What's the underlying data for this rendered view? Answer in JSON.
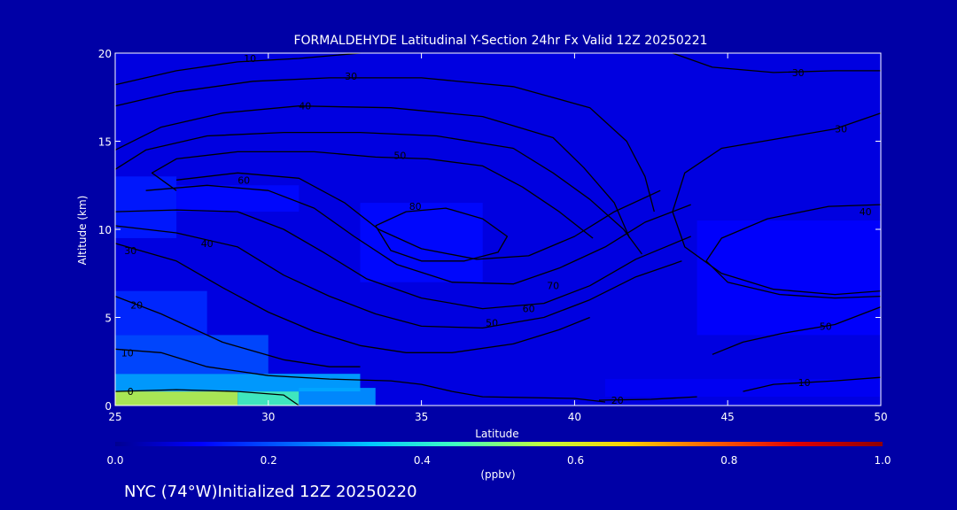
{
  "chart_data": {
    "type": "heatmap",
    "title": "FORMALDEHYDE Latitudinal Y-Section 24hr  Fx Valid 12Z 20250221",
    "xlabel": "Latitude",
    "ylabel": "Altitude (km)",
    "xlim": [
      25,
      50
    ],
    "ylim": [
      0,
      20
    ],
    "x_ticks": [
      "25",
      "30",
      "35",
      "40",
      "45",
      "50"
    ],
    "y_ticks": [
      "0",
      "5",
      "10",
      "15",
      "20"
    ],
    "colorbar": {
      "label": "(ppbv)",
      "range": [
        0.0,
        1.0
      ],
      "ticks": [
        "0.0",
        "0.2",
        "0.4",
        "0.6",
        "0.8",
        "1.0"
      ],
      "colors": [
        "#000090",
        "#0000ff",
        "#0060ff",
        "#00c8ff",
        "#40ffc0",
        "#c0ff40",
        "#ffd000",
        "#ff6000",
        "#e00000",
        "#900000"
      ]
    },
    "field_regions": [
      {
        "lat": [
          25,
          29
        ],
        "alt": [
          0,
          0.8
        ],
        "value": 0.55
      },
      {
        "lat": [
          29,
          31
        ],
        "alt": [
          0,
          0.8
        ],
        "value": 0.45
      },
      {
        "lat": [
          31,
          33.5
        ],
        "alt": [
          0,
          1.0
        ],
        "value": 0.28
      },
      {
        "lat": [
          25,
          33
        ],
        "alt": [
          0.8,
          1.8
        ],
        "value": 0.3
      },
      {
        "lat": [
          25,
          30
        ],
        "alt": [
          1.8,
          4.0
        ],
        "value": 0.2
      },
      {
        "lat": [
          25,
          28
        ],
        "alt": [
          4.0,
          6.5
        ],
        "value": 0.16
      },
      {
        "lat": [
          25,
          27
        ],
        "alt": [
          9.5,
          13.0
        ],
        "value": 0.14
      },
      {
        "lat": [
          27,
          31
        ],
        "alt": [
          11.0,
          12.5
        ],
        "value": 0.12
      },
      {
        "lat": [
          33,
          37
        ],
        "alt": [
          7.0,
          11.5
        ],
        "value": 0.12
      },
      {
        "lat": [
          41,
          50
        ],
        "alt": [
          0.5,
          1.5
        ],
        "value": 0.1
      },
      {
        "lat": [
          44,
          50
        ],
        "alt": [
          4.0,
          10.5
        ],
        "value": 0.11
      }
    ],
    "contours": [
      {
        "label": "0",
        "label_at": [
          25.5,
          0.8
        ],
        "points": [
          [
            25,
            0.8
          ],
          [
            27,
            0.9
          ],
          [
            29,
            0.8
          ],
          [
            30.5,
            0.6
          ],
          [
            31,
            0
          ]
        ]
      },
      {
        "label": "10",
        "label_at": [
          25.4,
          3.0
        ],
        "points": [
          [
            25,
            3.2
          ],
          [
            26.5,
            3.0
          ],
          [
            28,
            2.2
          ],
          [
            30,
            1.7
          ],
          [
            32,
            1.5
          ],
          [
            34,
            1.4
          ],
          [
            35,
            1.2
          ],
          [
            36,
            0.8
          ],
          [
            37,
            0.5
          ],
          [
            40,
            0.4
          ],
          [
            41,
            0.2
          ]
        ]
      },
      {
        "label": "20",
        "label_at": [
          25.7,
          5.7
        ],
        "points": [
          [
            25,
            6.2
          ],
          [
            26.5,
            5.2
          ],
          [
            28.5,
            3.6
          ],
          [
            30.5,
            2.6
          ],
          [
            32,
            2.2
          ],
          [
            33,
            2.2
          ]
        ]
      },
      {
        "label": "30",
        "label_at": [
          25.5,
          8.8
        ],
        "points": [
          [
            25,
            9.2
          ],
          [
            27,
            8.2
          ],
          [
            28.5,
            6.7
          ],
          [
            30,
            5.3
          ],
          [
            31.5,
            4.2
          ],
          [
            33,
            3.4
          ],
          [
            34.5,
            3.0
          ],
          [
            36,
            3.0
          ],
          [
            38,
            3.5
          ],
          [
            39.5,
            4.3
          ],
          [
            40.5,
            5.0
          ]
        ]
      },
      {
        "label": "40",
        "label_at": [
          28,
          9.2
        ],
        "points": [
          [
            25,
            10.2
          ],
          [
            27,
            9.8
          ],
          [
            29,
            9.0
          ],
          [
            30.5,
            7.4
          ],
          [
            32,
            6.2
          ],
          [
            33.5,
            5.2
          ],
          [
            35,
            4.5
          ],
          [
            37,
            4.4
          ],
          [
            39,
            5.0
          ],
          [
            40.5,
            6.0
          ],
          [
            42,
            7.3
          ],
          [
            43.5,
            8.2
          ]
        ]
      },
      {
        "label": "50",
        "label_at": [
          37.3,
          4.7
        ],
        "points": [
          [
            25,
            11.0
          ],
          [
            27,
            11.1
          ],
          [
            29,
            11.0
          ],
          [
            30.5,
            10.0
          ],
          [
            31.8,
            8.7
          ],
          [
            33.2,
            7.2
          ],
          [
            35,
            6.1
          ],
          [
            37,
            5.5
          ],
          [
            39,
            5.8
          ],
          [
            40.5,
            6.8
          ],
          [
            42,
            8.3
          ],
          [
            43.8,
            9.6
          ]
        ]
      },
      {
        "label": "60",
        "label_at": [
          38.5,
          5.5
        ],
        "points": [
          [
            26,
            12.2
          ],
          [
            28,
            12.5
          ],
          [
            30,
            12.2
          ],
          [
            31.5,
            11.2
          ],
          [
            32.8,
            9.6
          ],
          [
            34.2,
            8.0
          ],
          [
            36,
            7.0
          ],
          [
            38,
            6.9
          ],
          [
            39.5,
            7.8
          ],
          [
            41,
            9.0
          ],
          [
            42.3,
            10.4
          ],
          [
            43.8,
            11.4
          ]
        ]
      },
      {
        "label": "70",
        "label_at": [
          39.3,
          6.8
        ],
        "points": [
          [
            27,
            12.8
          ],
          [
            29,
            13.2
          ],
          [
            31,
            12.9
          ],
          [
            32.5,
            11.5
          ],
          [
            33.6,
            10.0
          ],
          [
            35,
            8.9
          ],
          [
            36.8,
            8.3
          ],
          [
            38.5,
            8.5
          ],
          [
            40,
            9.6
          ],
          [
            41.3,
            11.0
          ],
          [
            42.8,
            12.2
          ]
        ]
      },
      {
        "label": "80",
        "label_at": [
          34.8,
          11.3
        ],
        "points": [
          [
            33.5,
            10.2
          ],
          [
            34.5,
            11.0
          ],
          [
            35.8,
            11.2
          ],
          [
            37,
            10.6
          ],
          [
            37.8,
            9.6
          ],
          [
            37.5,
            8.7
          ],
          [
            36.4,
            8.2
          ],
          [
            35,
            8.2
          ],
          [
            34,
            8.8
          ],
          [
            33.5,
            10.2
          ]
        ]
      },
      {
        "label": "60",
        "label_at": [
          29.2,
          12.8
        ],
        "points": [
          [
            27,
            12.2
          ],
          [
            26.2,
            13.2
          ],
          [
            27,
            14.0
          ],
          [
            29,
            14.4
          ],
          [
            31.5,
            14.4
          ],
          [
            33.5,
            14.1
          ],
          [
            35.2,
            14.0
          ],
          [
            37,
            13.6
          ],
          [
            38.3,
            12.4
          ],
          [
            39.5,
            11.0
          ],
          [
            40.6,
            9.5
          ]
        ]
      },
      {
        "label": "50",
        "label_at": [
          34.3,
          14.2
        ],
        "points": [
          [
            25,
            13.4
          ],
          [
            26,
            14.5
          ],
          [
            28,
            15.3
          ],
          [
            30.5,
            15.5
          ],
          [
            33,
            15.5
          ],
          [
            35.5,
            15.3
          ],
          [
            38,
            14.6
          ],
          [
            39.3,
            13.2
          ],
          [
            40.5,
            11.7
          ],
          [
            41.6,
            10.0
          ],
          [
            42.2,
            8.6
          ]
        ]
      },
      {
        "label": "40",
        "label_at": [
          31.2,
          17.0
        ],
        "points": [
          [
            25,
            14.5
          ],
          [
            26.5,
            15.8
          ],
          [
            28.5,
            16.6
          ],
          [
            31,
            17.0
          ],
          [
            34,
            16.9
          ],
          [
            37,
            16.4
          ],
          [
            39.3,
            15.2
          ],
          [
            40.3,
            13.5
          ],
          [
            41.3,
            11.5
          ],
          [
            41.8,
            9.5
          ]
        ]
      },
      {
        "label": "30",
        "label_at": [
          32.7,
          18.7
        ],
        "points": [
          [
            25,
            17.0
          ],
          [
            27,
            17.8
          ],
          [
            29.5,
            18.4
          ],
          [
            32,
            18.6
          ],
          [
            35,
            18.6
          ],
          [
            38,
            18.1
          ],
          [
            40.5,
            16.9
          ],
          [
            41.7,
            15.0
          ],
          [
            42.3,
            13.0
          ],
          [
            42.6,
            11.0
          ]
        ]
      },
      {
        "label": "10",
        "label_at": [
          29.4,
          19.7
        ],
        "points": [
          [
            25,
            18.2
          ],
          [
            27,
            19.0
          ],
          [
            29,
            19.5
          ],
          [
            31,
            19.7
          ],
          [
            33,
            20.0
          ]
        ]
      },
      {
        "label": "30",
        "label_at": [
          47.3,
          18.9
        ],
        "points": [
          [
            43.2,
            20.0
          ],
          [
            44.5,
            19.2
          ],
          [
            46.5,
            18.9
          ],
          [
            48.5,
            19.0
          ],
          [
            50,
            19.0
          ]
        ]
      },
      {
        "label": "30",
        "label_at": [
          48.7,
          15.7
        ],
        "points": [
          [
            50,
            16.6
          ],
          [
            48.5,
            15.7
          ],
          [
            46.5,
            15.1
          ],
          [
            44.8,
            14.6
          ],
          [
            43.6,
            13.2
          ],
          [
            43.2,
            11.0
          ],
          [
            43.6,
            9.0
          ],
          [
            44.8,
            7.5
          ],
          [
            46.5,
            6.6
          ],
          [
            48.5,
            6.3
          ],
          [
            50,
            6.5
          ]
        ]
      },
      {
        "label": "40",
        "label_at": [
          49.5,
          11.0
        ],
        "points": [
          [
            50,
            11.4
          ],
          [
            48.3,
            11.3
          ],
          [
            46.3,
            10.6
          ],
          [
            44.8,
            9.5
          ],
          [
            44.3,
            8.2
          ],
          [
            45.0,
            7.0
          ],
          [
            46.7,
            6.3
          ],
          [
            48.5,
            6.1
          ],
          [
            50,
            6.2
          ]
        ]
      },
      {
        "label": "50",
        "label_at": [
          48.2,
          4.5
        ],
        "points": [
          [
            50,
            5.6
          ],
          [
            48.5,
            4.6
          ],
          [
            46.8,
            4.1
          ],
          [
            45.5,
            3.6
          ],
          [
            44.5,
            2.9
          ]
        ]
      },
      {
        "label": "10",
        "label_at": [
          47.5,
          1.3
        ],
        "points": [
          [
            45.5,
            0.8
          ],
          [
            46.5,
            1.2
          ],
          [
            48.5,
            1.4
          ],
          [
            50,
            1.6
          ]
        ]
      },
      {
        "label": "20",
        "label_at": [
          41.4,
          0.3
        ],
        "points": [
          [
            40.8,
            0.3
          ],
          [
            42.5,
            0.35
          ],
          [
            44,
            0.5
          ]
        ]
      }
    ]
  },
  "footer": {
    "location": "NYC (74°W)Initialized 12Z 20250220"
  }
}
